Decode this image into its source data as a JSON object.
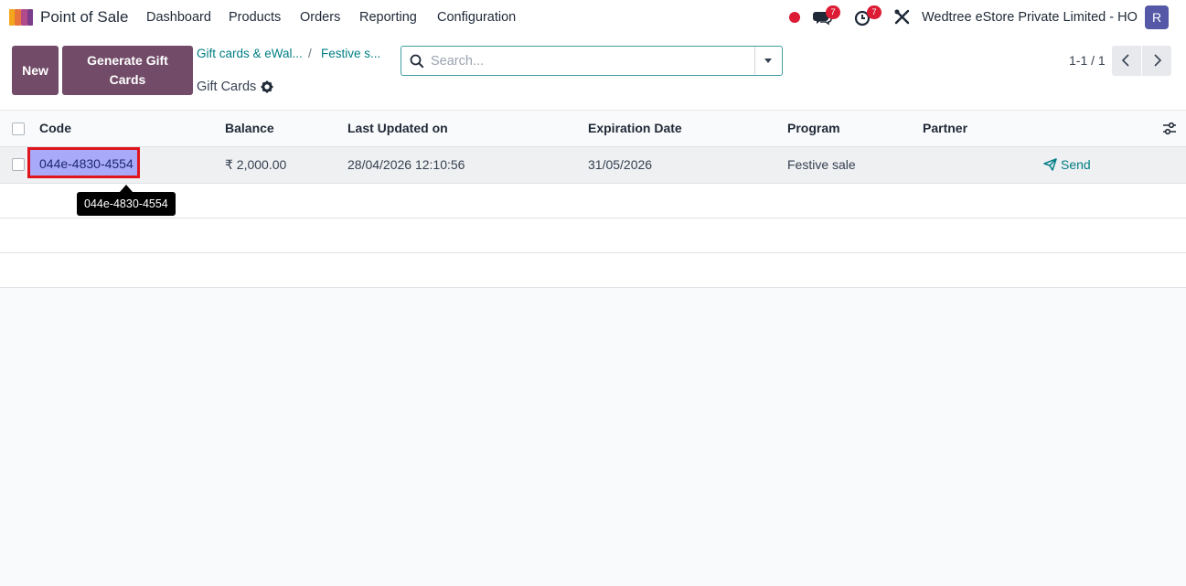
{
  "navbar": {
    "app_name": "Point of Sale",
    "menus": [
      "Dashboard",
      "Products",
      "Orders",
      "Reporting",
      "Configuration"
    ],
    "messages_badge": "7",
    "activities_badge": "7",
    "company": "Wedtree eStore Private Limited - HO",
    "avatar_initial": "R",
    "colors": {
      "brand": "#714b67",
      "badge": "#dc1b34",
      "avatar": "#5458a6"
    },
    "icons": [
      "app-logo-icon",
      "recording-dot-icon",
      "chat-icon",
      "clock-icon",
      "debug-tools-icon"
    ]
  },
  "control_panel": {
    "new_label": "New",
    "generate_label": "Generate Gift Cards",
    "breadcrumb": [
      "Gift cards & eWal...",
      "Festive s..."
    ],
    "page_title": "Gift Cards",
    "search_placeholder": "Search...",
    "search_value": "",
    "pager": "1-1 / 1"
  },
  "list": {
    "columns": [
      "Code",
      "Balance",
      "Last Updated on",
      "Expiration Date",
      "Program",
      "Partner"
    ],
    "rows": [
      {
        "code": "044e-4830-4554",
        "balance": "₹ 2,000.00",
        "last_updated": "28/04/2026 12:10:56",
        "expiration": "31/05/2026",
        "program": "Festive sale",
        "partner": "",
        "action": "Send"
      }
    ]
  },
  "tooltip": {
    "text": "044e-4830-4554"
  }
}
